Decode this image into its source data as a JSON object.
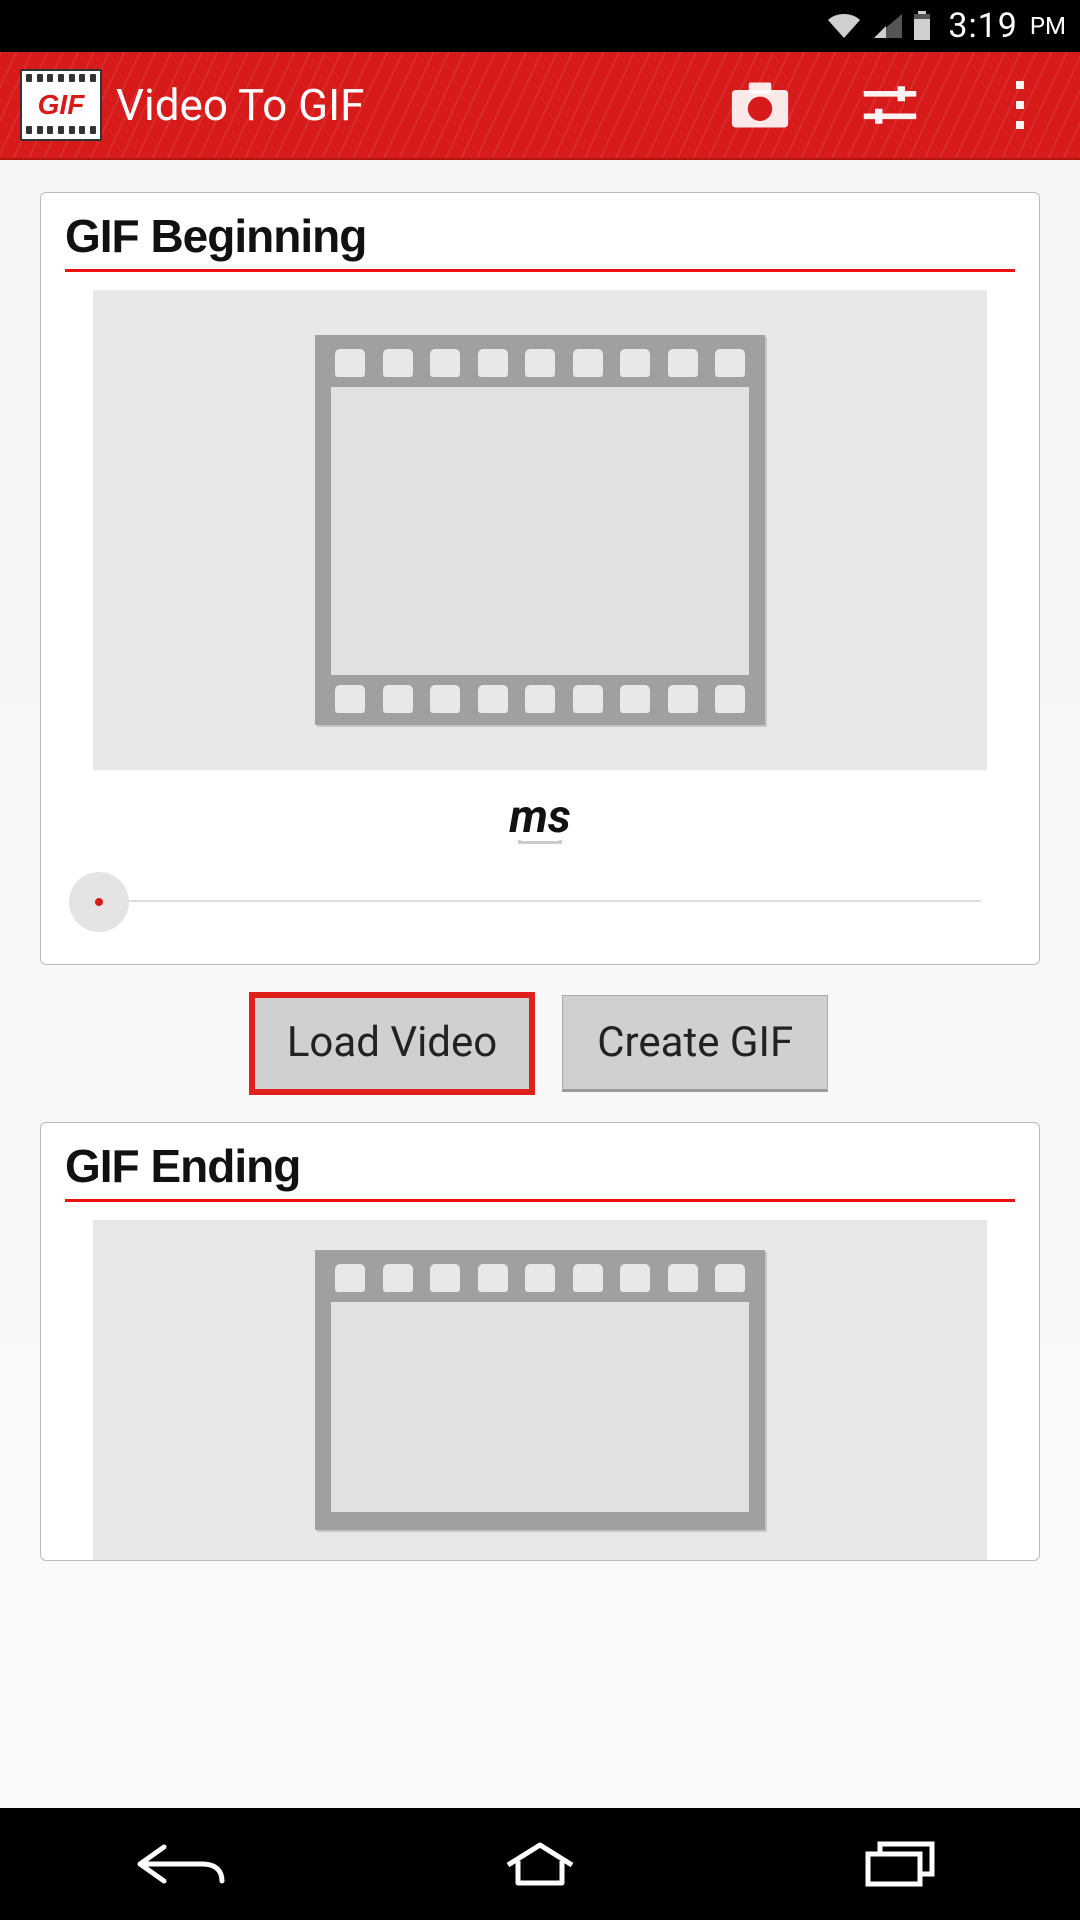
{
  "status_bar": {
    "time": "3:19",
    "ampm": "PM"
  },
  "action_bar": {
    "app_icon_text": "GIF",
    "title": "Video To GIF"
  },
  "panel_begin": {
    "title": "GIF Beginning",
    "ms_label": "ms"
  },
  "buttons": {
    "load_video": "Load Video",
    "create_gif": "Create GIF"
  },
  "panel_end": {
    "title": "GIF Ending"
  }
}
